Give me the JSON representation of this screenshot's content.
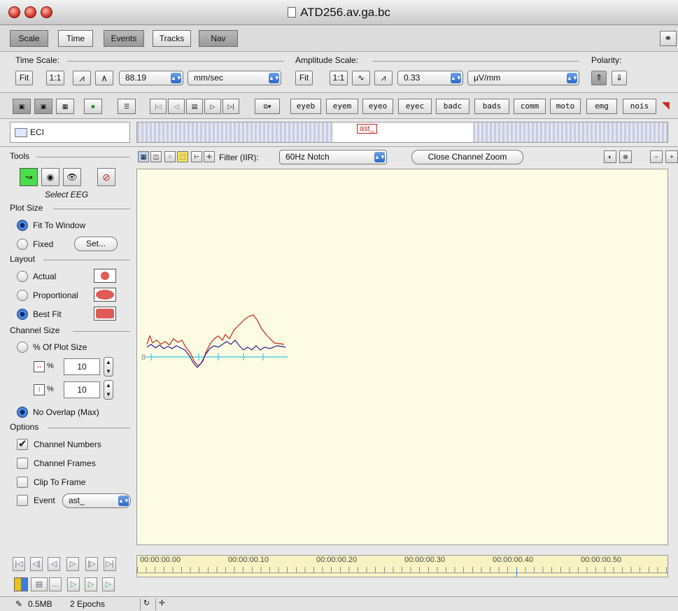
{
  "window": {
    "title": "ATD256.av.ga.bc"
  },
  "tabs": [
    "Scale",
    "Time",
    "Events",
    "Tracks",
    "Nav"
  ],
  "time_scale": {
    "label": "Time Scale:",
    "fit": "Fit",
    "one_to_one": "1:1",
    "value": "88.19",
    "unit": "mm/sec"
  },
  "amplitude_scale": {
    "label": "Amplitude Scale:",
    "fit": "Fit",
    "one_to_one": "1:1",
    "value": "0.33",
    "unit": "µV/mm"
  },
  "polarity": {
    "label": "Polarity:"
  },
  "event_buttons": [
    "eyeb",
    "eyem",
    "eyeo",
    "eyec",
    "badc",
    "bads",
    "comm",
    "moto",
    "emg",
    "nois"
  ],
  "eci_label": "ECI",
  "event_marker_label": "ast_",
  "sidebar": {
    "tools_label": "Tools",
    "tool_caption": "Select EEG",
    "plot_size_label": "Plot Size",
    "fit_to_window": "Fit To Window",
    "fixed": "Fixed",
    "set_button": "Set...",
    "layout_label": "Layout",
    "actual": "Actual",
    "proportional": "Proportional",
    "best_fit": "Best Fit",
    "channel_size_label": "Channel Size",
    "pct_of_plot": "% Of Plot Size",
    "width_pct": "10",
    "height_pct": "10",
    "pct_symbol": "%",
    "no_overlap": "No Overlap (Max)",
    "options_label": "Options",
    "channel_numbers": "Channel Numbers",
    "channel_frames": "Channel Frames",
    "clip_to_frame": "Clip To Frame",
    "event_label": "Event",
    "event_value": "ast_"
  },
  "plot_toolbar": {
    "filter_label": "Filter (IIR):",
    "filter_value": "60Hz Notch",
    "close_zoom": "Close Channel Zoom"
  },
  "channel_number": "8",
  "timeline": {
    "ticks": [
      "00:00:00.00",
      "00:00:00.10",
      "00:00:00.20",
      "00:00:00.30",
      "00:00:00.40",
      "00:00:00.50"
    ]
  },
  "status": {
    "memory": "0.5MB",
    "epochs": "2 Epochs"
  },
  "colors": {
    "red_trace": "#c8281e",
    "blue_trace": "#2a1f8c",
    "baseline": "#5ad0e6",
    "plot_bg": "#fdfbe3"
  }
}
